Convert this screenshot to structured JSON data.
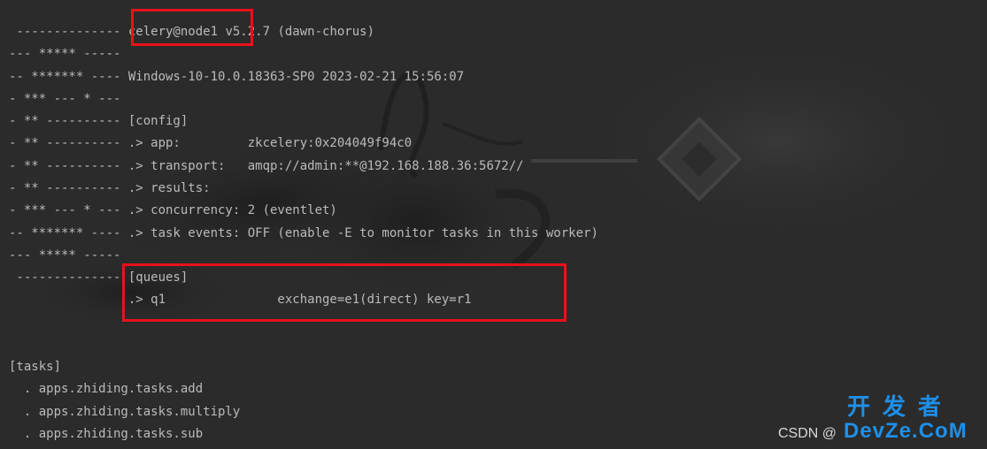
{
  "terminal": {
    "lines": [
      {
        "pre": " -------------- ",
        "mark": "celery@node1",
        "post": " v5.2.7 (dawn-chorus)"
      },
      {
        "text": "--- ***** -----"
      },
      {
        "text": "-- ******* ---- Windows-10-10.0.18363-SP0 2023-02-21 15:56:07"
      },
      {
        "text": "- *** --- * ---"
      },
      {
        "text": "- ** ---------- [config]"
      },
      {
        "text": "- ** ---------- .> app:         zkcelery:0x204049f94c0"
      },
      {
        "text": "- ** ---------- .> transport:   amqp://admin:**@192.168.188.36:5672//"
      },
      {
        "text": "- ** ---------- .> results:"
      },
      {
        "text": "- *** --- * --- .> concurrency: 2 (eventlet)"
      },
      {
        "text": "-- ******* ---- .> task events: OFF (enable -E to monitor tasks in this worker)"
      },
      {
        "text": "--- ***** -----"
      },
      {
        "pre": " -------------- ",
        "mark": "[queues]",
        "post": ""
      },
      {
        "text": "                .> q1               exchange=e1(direct) key=r1"
      },
      {
        "text": ""
      },
      {
        "text": ""
      },
      {
        "text": "[tasks]"
      },
      {
        "text": "  . apps.zhiding.tasks.add"
      },
      {
        "text": "  . apps.zhiding.tasks.multiply"
      },
      {
        "text": "  . apps.zhiding.tasks.sub"
      }
    ]
  },
  "highlight_color": "#e8121b",
  "watermark": {
    "csdn": "CSDN @",
    "cn": "开发者",
    "en": "DevZe.CoM"
  }
}
